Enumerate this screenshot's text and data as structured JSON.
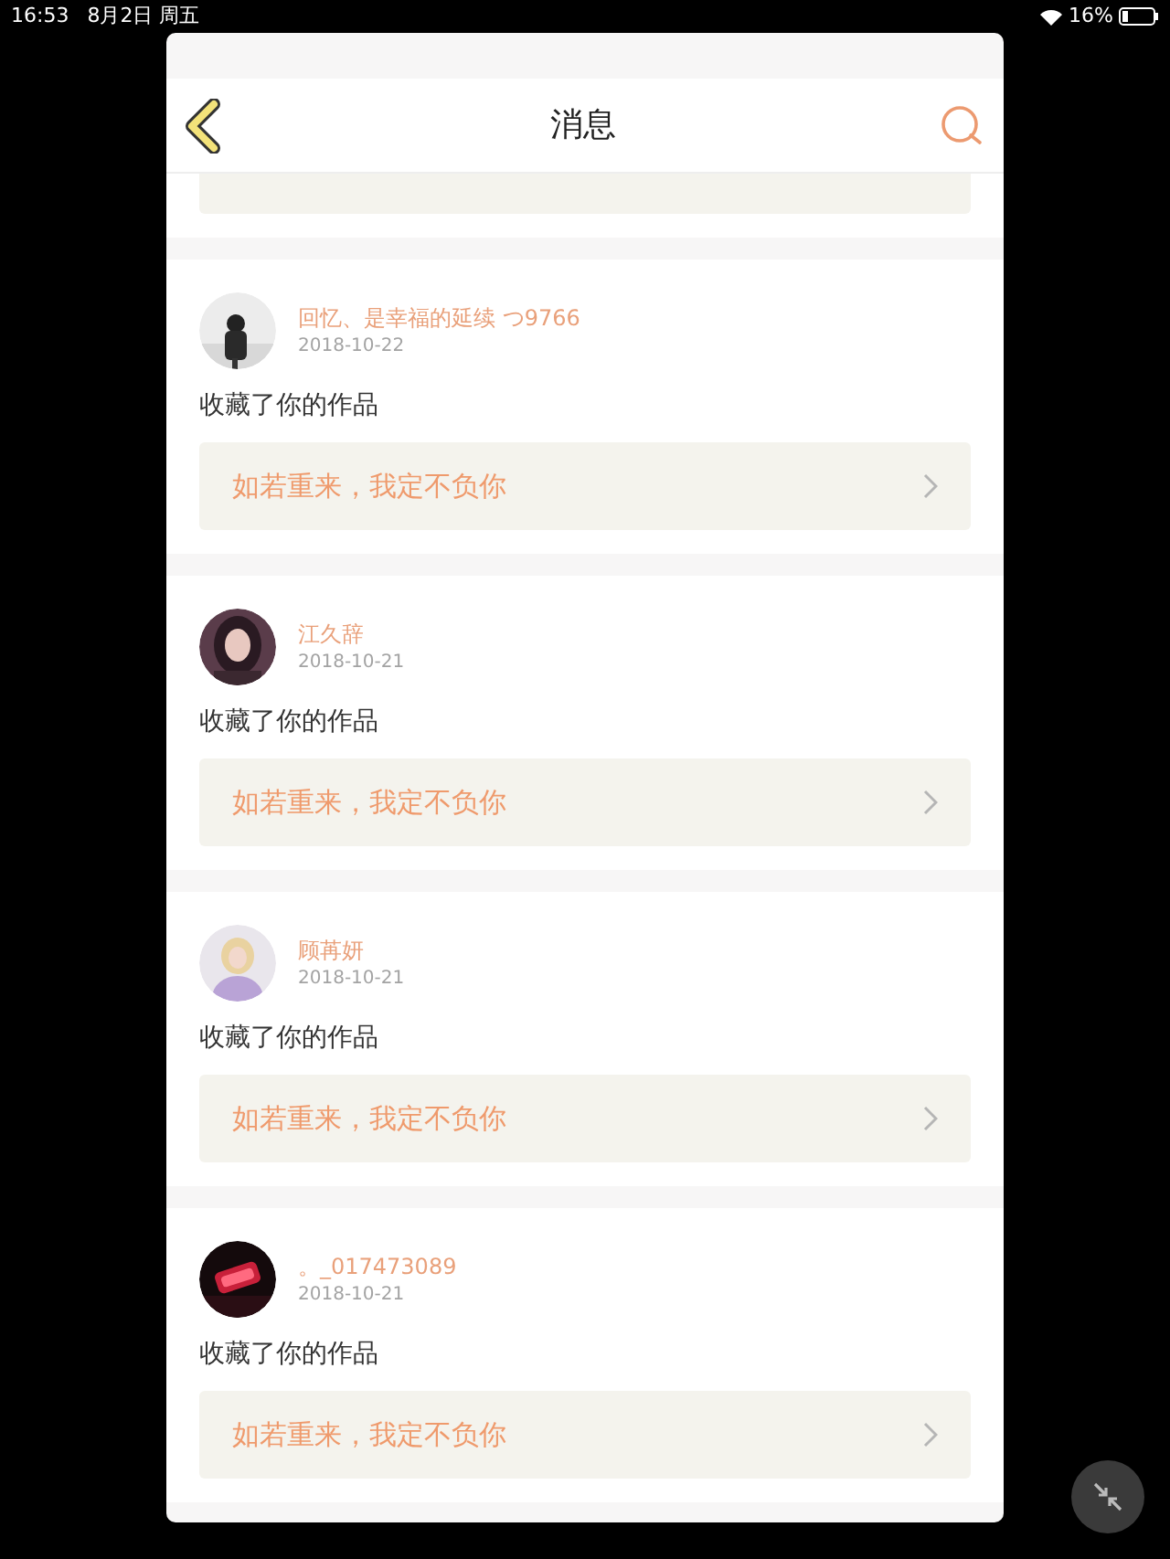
{
  "status_bar": {
    "time": "16:53",
    "date": "8月2日 周五",
    "battery": "16%"
  },
  "header": {
    "title": "消息"
  },
  "messages": [
    {
      "name": "回忆、是幸福的延续 つ9766",
      "date": "2018-10-22",
      "action": "收藏了你的作品",
      "work": "如若重来，我定不负你"
    },
    {
      "name": "江久辞",
      "date": "2018-10-21",
      "action": "收藏了你的作品",
      "work": "如若重来，我定不负你"
    },
    {
      "name": "顾苒妍",
      "date": "2018-10-21",
      "action": "收藏了你的作品",
      "work": "如若重来，我定不负你"
    },
    {
      "name": "。_017473089",
      "date": "2018-10-21",
      "action": "收藏了你的作品",
      "work": "如若重来，我定不负你"
    }
  ]
}
